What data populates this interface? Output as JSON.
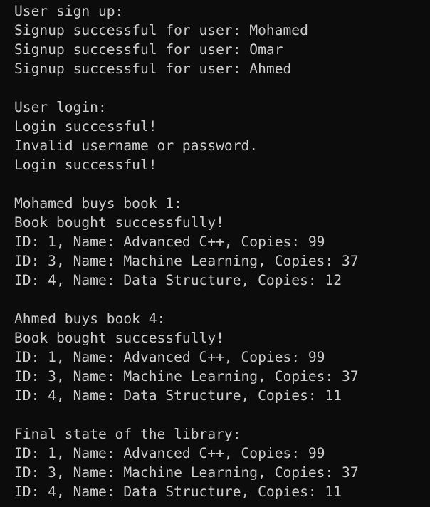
{
  "console": {
    "lines": [
      "User sign up:",
      "Signup successful for user: Mohamed",
      "Signup successful for user: Omar",
      "Signup successful for user: Ahmed",
      "",
      "User login:",
      "Login successful!",
      "Invalid username or password.",
      "Login successful!",
      "",
      "Mohamed buys book 1:",
      "Book bought successfully!",
      "ID: 1, Name: Advanced C++, Copies: 99",
      "ID: 3, Name: Machine Learning, Copies: 37",
      "ID: 4, Name: Data Structure, Copies: 12",
      "",
      "Ahmed buys book 4:",
      "Book bought successfully!",
      "ID: 1, Name: Advanced C++, Copies: 99",
      "ID: 3, Name: Machine Learning, Copies: 37",
      "ID: 4, Name: Data Structure, Copies: 11",
      "",
      "Final state of the library:",
      "ID: 1, Name: Advanced C++, Copies: 99",
      "ID: 3, Name: Machine Learning, Copies: 37",
      "ID: 4, Name: Data Structure, Copies: 11"
    ]
  }
}
